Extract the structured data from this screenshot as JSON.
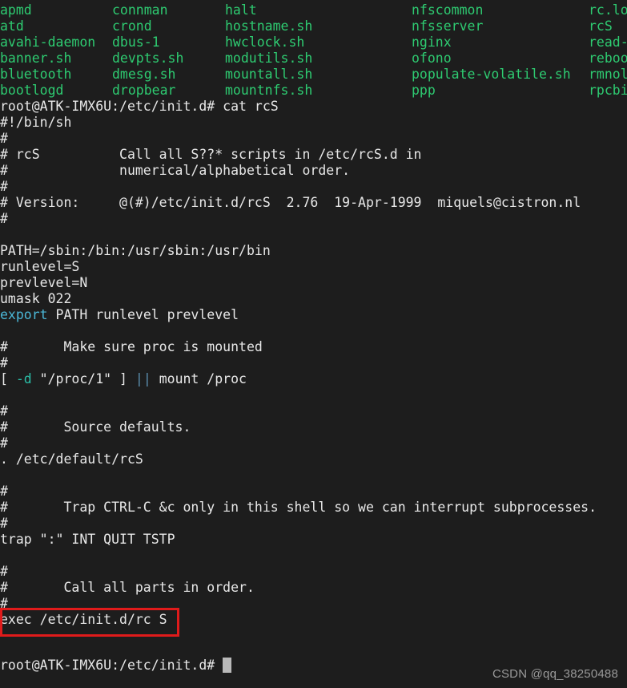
{
  "terminal": {
    "background_color": "#1d1d1d",
    "foreground_color": "#e8e8e8",
    "listing_color": "#2ecb71",
    "accent_red": "#e01b1b",
    "keyword_cyan": "#4bb8d8",
    "flag_teal": "#2bbfa8",
    "operator_blue": "#5b8fb0"
  },
  "ls_listing": {
    "rows": [
      [
        "apmd",
        "connman",
        "halt",
        "nfscommon",
        "rc.lo"
      ],
      [
        "atd",
        "crond",
        "hostname.sh",
        "nfsserver",
        "rcS"
      ],
      [
        "avahi-daemon",
        "dbus-1",
        "hwclock.sh",
        "nginx",
        "read-"
      ],
      [
        "banner.sh",
        "devpts.sh",
        "modutils.sh",
        "ofono",
        "reboo"
      ],
      [
        "bluetooth",
        "dmesg.sh",
        "mountall.sh",
        "populate-volatile.sh",
        "rmnol"
      ],
      [
        "bootlogd",
        "dropbear",
        "mountnfs.sh",
        "ppp",
        "rpcbi"
      ]
    ]
  },
  "command_line": {
    "prompt": "root@ATK-IMX6U:/etc/init.d# ",
    "command": "cat rcS"
  },
  "script": {
    "lines": [
      "#!/bin/sh",
      "#",
      "# rcS          Call all S??* scripts in /etc/rcS.d in",
      "#              numerical/alphabetical order.",
      "#",
      "# Version:     @(#)/etc/init.d/rcS  2.76  19-Apr-1999  miquels@cistron.nl",
      "#",
      "",
      "PATH=/sbin:/bin:/usr/sbin:/usr/bin",
      "runlevel=S",
      "prevlevel=N",
      "umask 022",
      "",
      "",
      "#       Make sure proc is mounted",
      "#",
      "",
      "",
      "#",
      "#       Source defaults.",
      "#",
      ". /etc/default/rcS",
      "",
      "#",
      "#       Trap CTRL-C &c only in this shell so we can interrupt subprocesses.",
      "#",
      "trap \":\" INT QUIT TSTP",
      "",
      "#",
      "#       Call all parts in order.",
      "#",
      ""
    ],
    "export_line": {
      "keyword": "export",
      "rest": " PATH runlevel prevlevel"
    },
    "proc_test_line": {
      "open_bracket": "[ ",
      "flag": "-d",
      "middle": " \"/proc/1\" ] ",
      "operator": "||",
      "tail": " mount /proc"
    },
    "exec_line": "exec /etc/init.d/rc S"
  },
  "bottom_prompt": {
    "text": "root@ATK-IMX6U:/etc/init.d# "
  },
  "watermark": {
    "text": "CSDN @qq_38250488"
  },
  "annotation": {
    "label": "red-highlight-box-around-exec-line"
  }
}
